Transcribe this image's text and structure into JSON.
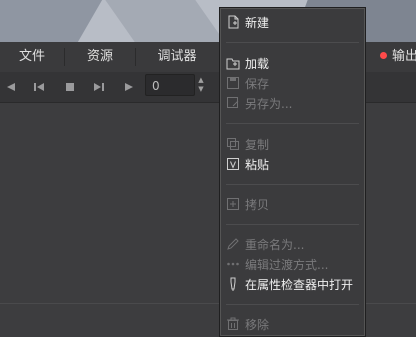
{
  "menubar": {
    "items": [
      "文件",
      "资源",
      "调试器"
    ],
    "output_tab": "输出"
  },
  "toolbar": {
    "frame_value": "0"
  },
  "context_menu": {
    "items": [
      {
        "label": "新建",
        "icon": "new-file-icon",
        "enabled": true
      },
      {
        "label": "加载",
        "icon": "load-icon",
        "enabled": true
      },
      {
        "label": "保存",
        "icon": "save-icon",
        "enabled": false
      },
      {
        "label": "另存为...",
        "icon": "save-as-icon",
        "enabled": false
      },
      {
        "label": "复制",
        "icon": "duplicate-icon",
        "enabled": false
      },
      {
        "label": "粘贴",
        "icon": "paste-icon",
        "enabled": true
      },
      {
        "label": "拷贝",
        "icon": "copy-icon",
        "enabled": false
      },
      {
        "label": "重命名为...",
        "icon": "rename-icon",
        "enabled": false
      },
      {
        "label": "编辑过渡方式...",
        "icon": "ellipsis-icon",
        "enabled": false
      },
      {
        "label": "在属性检查器中打开",
        "icon": "inspector-icon",
        "enabled": true
      },
      {
        "label": "移除",
        "icon": "trash-icon",
        "enabled": false
      }
    ]
  },
  "colors": {
    "accent_dot": "#ff4a4a",
    "menu_bg": "#3b3b3d"
  }
}
